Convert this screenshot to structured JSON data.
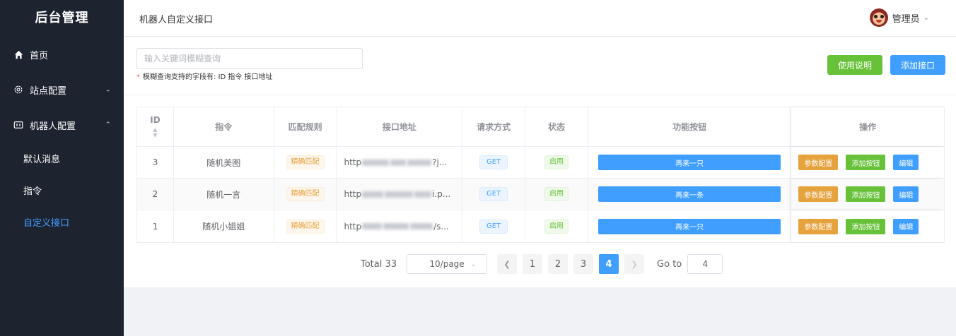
{
  "sidebar": {
    "brand": "后台管理",
    "items": [
      {
        "label": "首页",
        "icon": "home-icon"
      },
      {
        "label": "站点配置",
        "icon": "gear-icon",
        "arrow": "chevron-down-icon"
      },
      {
        "label": "机器人配置",
        "icon": "robot-icon",
        "arrow": "chevron-up-icon"
      }
    ],
    "sub_items": [
      {
        "label": "默认消息"
      },
      {
        "label": "指令"
      },
      {
        "label": "自定义接口",
        "active": true
      }
    ]
  },
  "header": {
    "breadcrumb": "机器人自定义接口",
    "user": "管理员"
  },
  "search": {
    "placeholder": "输入关键词模糊查询",
    "hint": "模糊查询支持的字段有: ID 指令 接口地址"
  },
  "toolbar": {
    "help_label": "使用说明",
    "add_label": "添加接口"
  },
  "table": {
    "columns": [
      "ID",
      "指令",
      "匹配规则",
      "接口地址",
      "请求方式",
      "状态",
      "功能按钮",
      "操作"
    ],
    "rows": [
      {
        "id": "3",
        "command": "随机美图",
        "rule": "精确匹配",
        "url_prefix": "http",
        "url_suffix": "?j...",
        "method": "GET",
        "state": "启用",
        "func_button": "再来一只"
      },
      {
        "id": "2",
        "command": "随机一言",
        "rule": "精确匹配",
        "url_prefix": "http",
        "url_suffix": "i.p...",
        "method": "GET",
        "state": "启用",
        "func_button": "再来一条"
      },
      {
        "id": "1",
        "command": "随机小姐姐",
        "rule": "精确匹配",
        "url_prefix": "http",
        "url_suffix": "/s...",
        "method": "GET",
        "state": "启用",
        "func_button": "再来一只"
      }
    ],
    "ops": {
      "param": "参数配置",
      "add_button": "添加按钮",
      "edit": "编辑"
    }
  },
  "pagination": {
    "total": "Total 33",
    "page_size": "10/page",
    "pages": [
      "1",
      "2",
      "3",
      "4"
    ],
    "current": "4",
    "goto_label": "Go to",
    "goto_value": "4"
  },
  "colors": {
    "sidebar_bg": "#1e2330",
    "primary": "#409eff",
    "success": "#67c23a",
    "warning": "#e6a23c"
  }
}
